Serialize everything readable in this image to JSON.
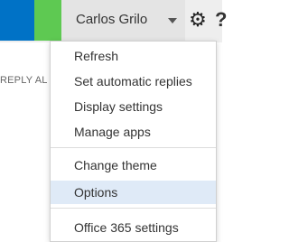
{
  "topbar": {
    "user_name": "Carlos Grilo",
    "user_caret_icon": "chevron-down-icon",
    "settings_icon": "gear-icon",
    "help_icon": "help-icon",
    "help_partial_glyph": "?"
  },
  "background": {
    "reply_all_partial": "REPLY AL"
  },
  "menu": {
    "items": [
      {
        "label": "Refresh"
      },
      {
        "label": "Set automatic replies"
      },
      {
        "label": "Display settings"
      },
      {
        "label": "Manage apps"
      },
      {
        "label": "Change theme"
      },
      {
        "label": "Options",
        "selected": true
      },
      {
        "label": "Office 365 settings"
      }
    ]
  },
  "colors": {
    "blue_tile": "#0072c6",
    "green_tile": "#5ec952",
    "selected_item": "#dfeaf7"
  }
}
